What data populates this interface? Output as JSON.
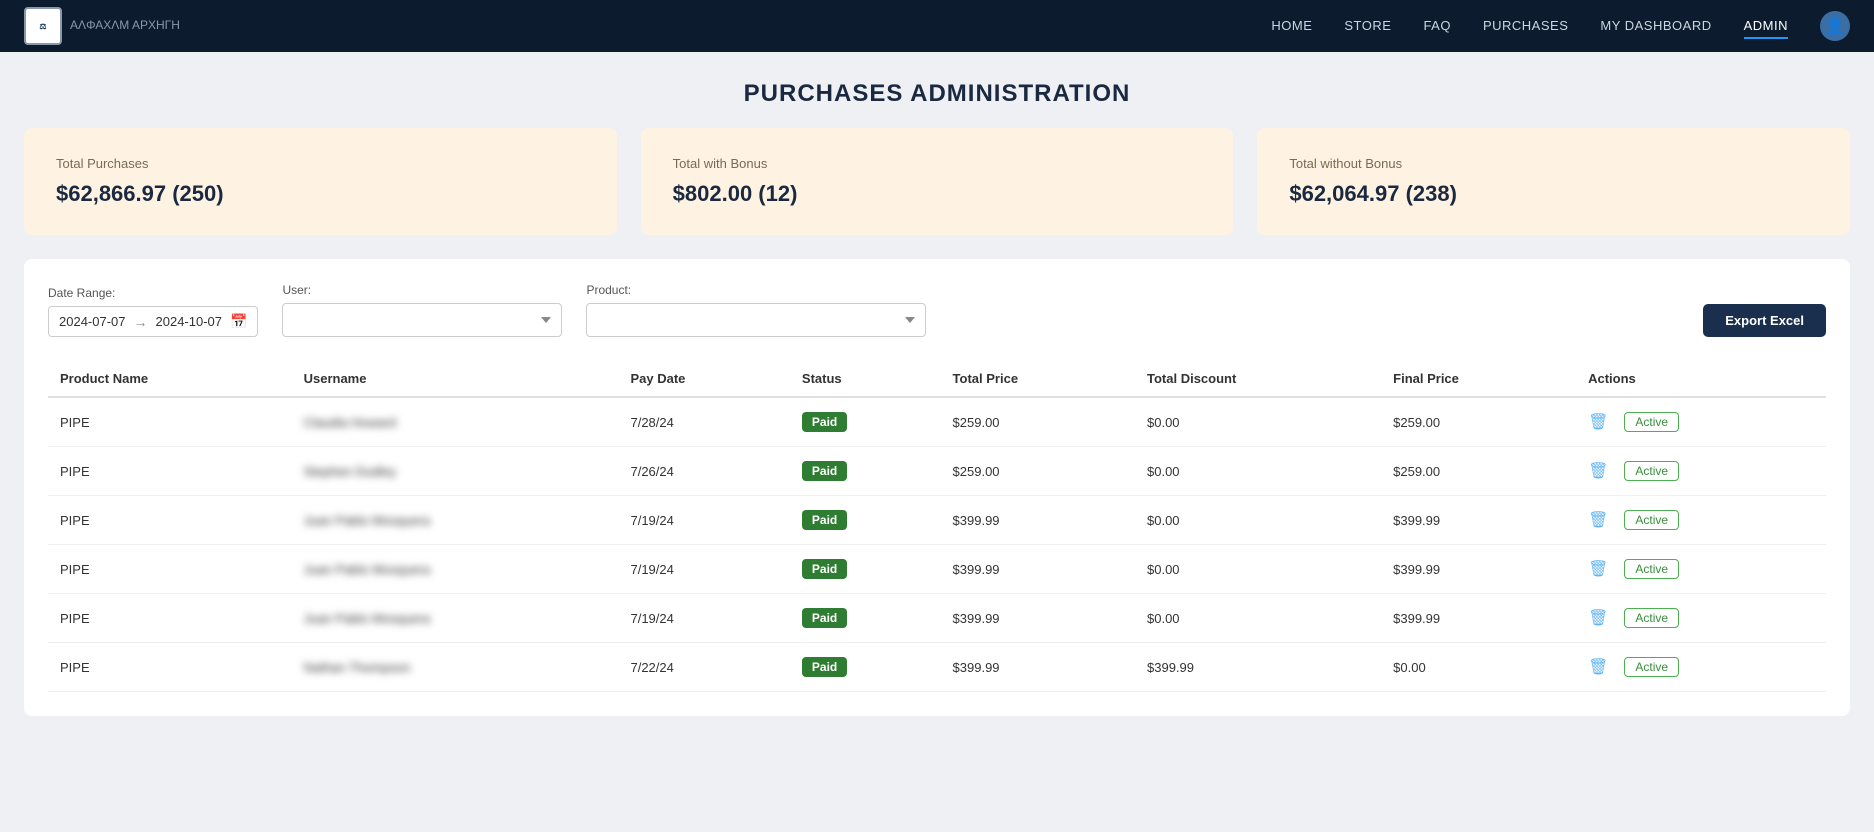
{
  "nav": {
    "logo_text": "ΑΛΦΑΧΛΜ\nΑΡΧΗΓΗ",
    "links": [
      {
        "label": "HOME",
        "active": false
      },
      {
        "label": "STORE",
        "active": false
      },
      {
        "label": "FAQ",
        "active": false
      },
      {
        "label": "PURCHASES",
        "active": false
      },
      {
        "label": "MY DASHBOARD",
        "active": false
      },
      {
        "label": "ADMIN",
        "active": true
      }
    ]
  },
  "page": {
    "title": "PURCHASES ADMINISTRATION"
  },
  "summary_cards": [
    {
      "label": "Total Purchases",
      "value": "$62,866.97 (250)"
    },
    {
      "label": "Total with Bonus",
      "value": "$802.00 (12)"
    },
    {
      "label": "Total without Bonus",
      "value": "$62,064.97 (238)"
    }
  ],
  "filters": {
    "date_range_label": "Date Range:",
    "date_start": "2024-07-07",
    "date_end": "2024-10-07",
    "user_label": "User:",
    "user_placeholder": "",
    "product_label": "Product:",
    "product_placeholder": "",
    "export_button": "Export Excel"
  },
  "table": {
    "columns": [
      "Product Name",
      "Username",
      "Pay Date",
      "Status",
      "Total Price",
      "Total Discount",
      "Final Price",
      "Actions"
    ],
    "rows": [
      {
        "product": "PIPE",
        "username": "Claudia Howard",
        "pay_date": "7/28/24",
        "status": "Paid",
        "total_price": "$259.00",
        "total_discount": "$0.00",
        "final_price": "$259.00",
        "action_status": "Active"
      },
      {
        "product": "PIPE",
        "username": "Stephen Dudley",
        "pay_date": "7/26/24",
        "status": "Paid",
        "total_price": "$259.00",
        "total_discount": "$0.00",
        "final_price": "$259.00",
        "action_status": "Active"
      },
      {
        "product": "PIPE",
        "username": "Juan Pablo Mosquera",
        "pay_date": "7/19/24",
        "status": "Paid",
        "total_price": "$399.99",
        "total_discount": "$0.00",
        "final_price": "$399.99",
        "action_status": "Active"
      },
      {
        "product": "PIPE",
        "username": "Juan Pablo Mosquera",
        "pay_date": "7/19/24",
        "status": "Paid",
        "total_price": "$399.99",
        "total_discount": "$0.00",
        "final_price": "$399.99",
        "action_status": "Active"
      },
      {
        "product": "PIPE",
        "username": "Juan Pablo Mosquera",
        "pay_date": "7/19/24",
        "status": "Paid",
        "total_price": "$399.99",
        "total_discount": "$0.00",
        "final_price": "$399.99",
        "action_status": "Active"
      },
      {
        "product": "PIPE",
        "username": "Nathan Thompson",
        "pay_date": "7/22/24",
        "status": "Paid",
        "total_price": "$399.99",
        "total_discount": "$399.99",
        "final_price": "$0.00",
        "action_status": "Active"
      }
    ]
  }
}
